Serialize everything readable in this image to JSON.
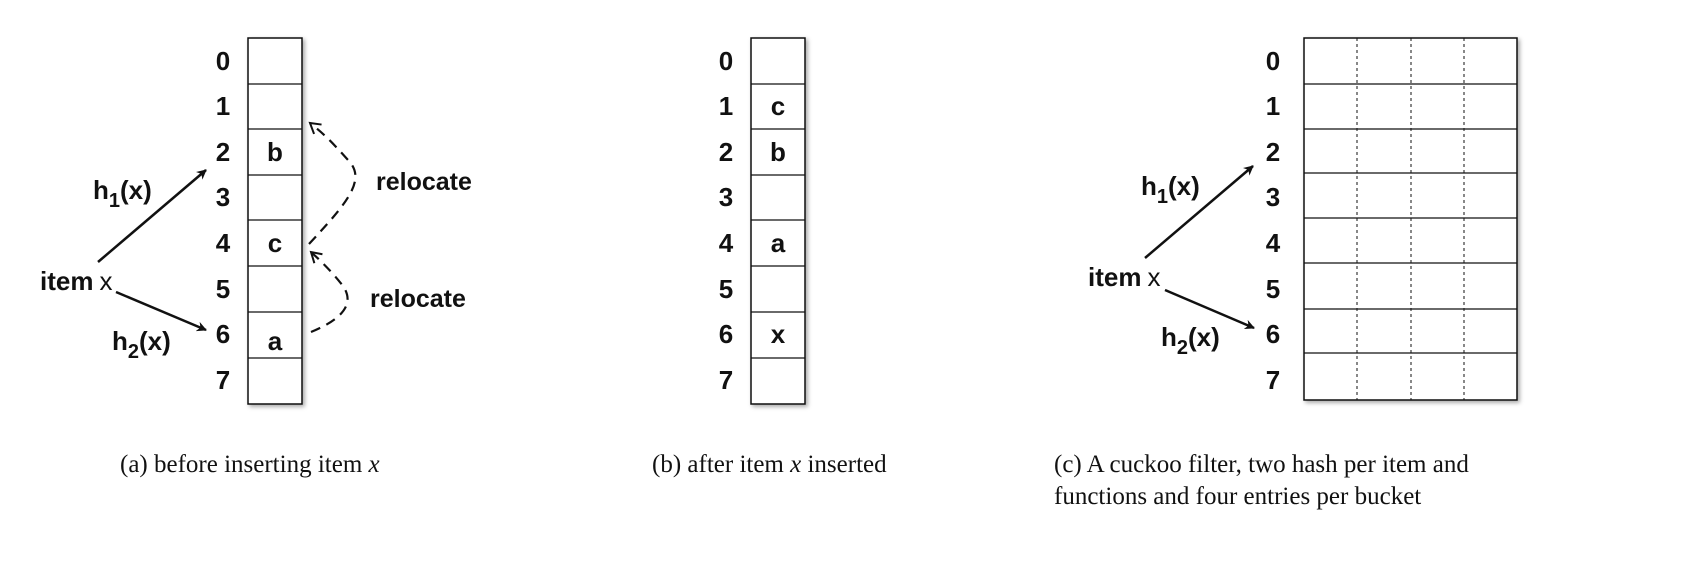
{
  "panels": [
    {
      "id": "a",
      "bucket_indices": [
        "0",
        "1",
        "2",
        "3",
        "4",
        "5",
        "6",
        "7"
      ],
      "cells": [
        "",
        "",
        "b",
        "",
        "c",
        "",
        "a",
        ""
      ],
      "item_label": "item",
      "item_var": "x",
      "h1_main": "h",
      "h1_sub": "1",
      "h1_arg": "(x)",
      "h2_main": "h",
      "h2_sub": "2",
      "h2_arg": "(x)",
      "relocate_top": "relocate",
      "relocate_bottom": "relocate",
      "caption_prefix": "(a)  before inserting item ",
      "caption_var": "x"
    },
    {
      "id": "b",
      "bucket_indices": [
        "0",
        "1",
        "2",
        "3",
        "4",
        "5",
        "6",
        "7"
      ],
      "cells": [
        "",
        "c",
        "b",
        "",
        "a",
        "",
        "x",
        ""
      ],
      "caption_prefix": "(b)  after item ",
      "caption_var": "x",
      "caption_suffix": " inserted"
    },
    {
      "id": "c",
      "bucket_indices": [
        "0",
        "1",
        "2",
        "3",
        "4",
        "5",
        "6",
        "7"
      ],
      "item_label": "item",
      "item_var": "x",
      "h1_main": "h",
      "h1_sub": "1",
      "h1_arg": "(x)",
      "h2_main": "h",
      "h2_sub": "2",
      "h2_arg": "(x)",
      "caption_line1": "(c)  A cuckoo filter, two hash per item and",
      "caption_line2": "functions and four entries per bucket"
    }
  ]
}
